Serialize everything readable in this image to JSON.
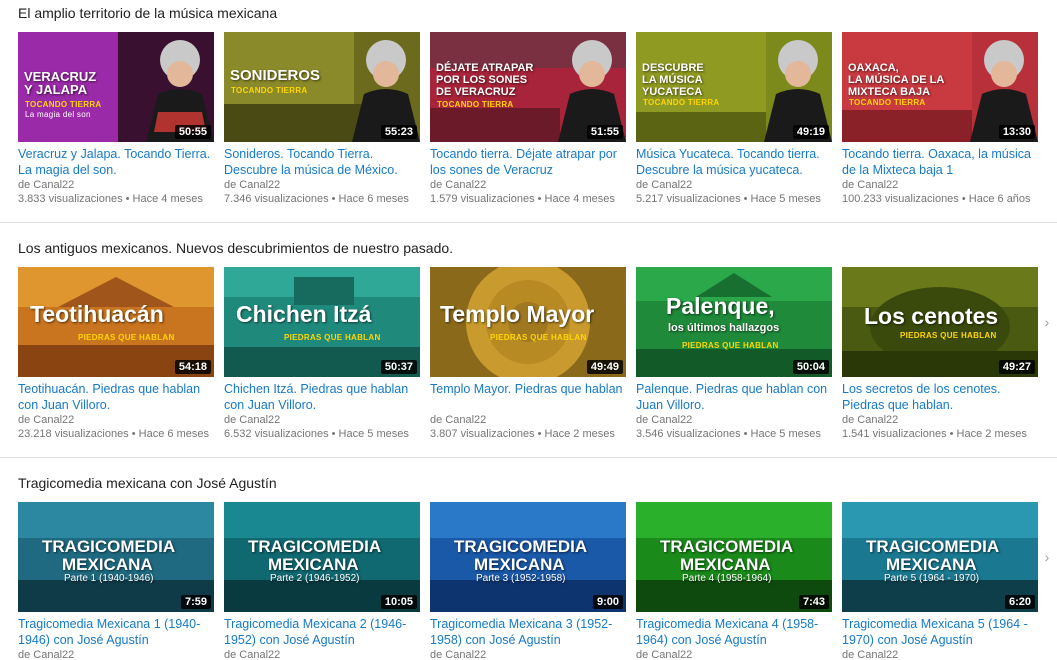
{
  "shelves": [
    {
      "title": "El amplio territorio de la música mexicana",
      "videos": [
        {
          "title": "Veracruz y Jalapa. Tocando Tierra. La magia del son.",
          "channel": "de Canal22",
          "views": "3.833 visualizaciones",
          "age": "Hace 4 meses",
          "duration": "50:55",
          "thumb_text": "VERACRUZ Y JALAPA",
          "thumb_sub": "TOCANDO TIERRA",
          "thumb_sub2": "La magia del son"
        },
        {
          "title": "Sonideros. Tocando Tierra. Descubre la música de México.",
          "channel": "de Canal22",
          "views": "7.346 visualizaciones",
          "age": "Hace 6 meses",
          "duration": "55:23",
          "thumb_text": "SONIDEROS",
          "thumb_sub": "TOCANDO TIERRA"
        },
        {
          "title": "Tocando tierra. Déjate atrapar por los sones de Veracruz",
          "channel": "de Canal22",
          "views": "1.579 visualizaciones",
          "age": "Hace 4 meses",
          "duration": "51:55",
          "thumb_text": "DÉJATE ATRAPAR POR LOS SONES DE VERACRUZ",
          "thumb_sub": "TOCANDO TIERRA"
        },
        {
          "title": "Música Yucateca. Tocando tierra. Descubre la música yucateca.",
          "channel": "de Canal22",
          "views": "5.217 visualizaciones",
          "age": "Hace 5 meses",
          "duration": "49:19",
          "thumb_text": "DESCUBRE LA MÚSICA YUCATECA",
          "thumb_sub": "TOCANDO TIERRA"
        },
        {
          "title": "Tocando tierra. Oaxaca, la música de la Mixteca baja 1",
          "channel": "de Canal22",
          "views": "100.233 visualizaciones",
          "age": "Hace 6 años",
          "duration": "13:30",
          "thumb_text": "OAXACA, LA MÚSICA DE LA MIXTECA BAJA",
          "thumb_sub": "TOCANDO TIERRA"
        }
      ]
    },
    {
      "title": "Los antiguos mexicanos. Nuevos descubrimientos de nuestro pasado.",
      "videos": [
        {
          "title": "Teotihuacán. Piedras que hablan con Juan Villoro.",
          "channel": "de Canal22",
          "views": "23.218 visualizaciones",
          "age": "Hace 6 meses",
          "duration": "54:18",
          "thumb_text": "Teotihuacán",
          "thumb_sub": "PIEDRAS QUE HABLAN"
        },
        {
          "title": "Chichen Itzá. Piedras que hablan con Juan Villoro.",
          "channel": "de Canal22",
          "views": "6.532 visualizaciones",
          "age": "Hace 5 meses",
          "duration": "50:37",
          "thumb_text": "Chichen Itzá",
          "thumb_sub": "PIEDRAS QUE HABLAN"
        },
        {
          "title": "Templo Mayor. Piedras que hablan",
          "channel": "de Canal22",
          "views": "3.807 visualizaciones",
          "age": "Hace 2 meses",
          "duration": "49:49",
          "thumb_text": "Templo Mayor",
          "thumb_sub": "PIEDRAS QUE HABLAN"
        },
        {
          "title": "Palenque. Piedras que hablan con Juan Villoro.",
          "channel": "de Canal22",
          "views": "3.546 visualizaciones",
          "age": "Hace 5 meses",
          "duration": "50:04",
          "thumb_text": "Palenque,",
          "thumb_sub2": "los últimos hallazgos",
          "thumb_sub": "PIEDRAS QUE HABLAN"
        },
        {
          "title": "Los secretos de los cenotes. Piedras que hablan.",
          "channel": "de Canal22",
          "views": "1.541 visualizaciones",
          "age": "Hace 2 meses",
          "duration": "49:27",
          "thumb_text": "Los cenotes",
          "thumb_sub": "PIEDRAS QUE HABLAN"
        }
      ]
    },
    {
      "title": "Tragicomedia mexicana con José Agustín",
      "videos": [
        {
          "title": "Tragicomedia Mexicana 1 (1940-1946) con José Agustín",
          "channel": "de Canal22",
          "duration": "7:59",
          "thumb_text": "TRAGICOMEDIA",
          "thumb_text2": "MEXICANA",
          "thumb_sub": "Parte 1 (1940-1946)"
        },
        {
          "title": "Tragicomedia Mexicana 2 (1946-1952) con José Agustín",
          "channel": "de Canal22",
          "duration": "10:05",
          "thumb_text": "TRAGICOMEDIA",
          "thumb_text2": "MEXICANA",
          "thumb_sub": "Parte 2 (1946-1952)"
        },
        {
          "title": "Tragicomedia Mexicana 3 (1952-1958) con José Agustín",
          "channel": "de Canal22",
          "duration": "9:00",
          "thumb_text": "TRAGICOMEDIA",
          "thumb_text2": "MEXICANA",
          "thumb_sub": "Parte 3 (1952-1958)"
        },
        {
          "title": "Tragicomedia Mexicana 4 (1958-1964) con José Agustín",
          "channel": "de Canal22",
          "duration": "7:43",
          "thumb_text": "TRAGICOMEDIA",
          "thumb_text2": "MEXICANA",
          "thumb_sub": "Parte 4 (1958-1964)"
        },
        {
          "title": "Tragicomedia Mexicana 5 (1964 - 1970) con José Agustín",
          "channel": "de Canal22",
          "duration": "6:20",
          "thumb_text": "TRAGICOMEDIA",
          "thumb_text2": "MEXICANA",
          "thumb_sub": "Parte 5 (1964 - 1970)"
        }
      ]
    }
  ],
  "icons": {
    "next": "chevron-right-icon"
  },
  "colors": {
    "link": "#167ac6",
    "meta": "#767676",
    "title": "#222222"
  }
}
